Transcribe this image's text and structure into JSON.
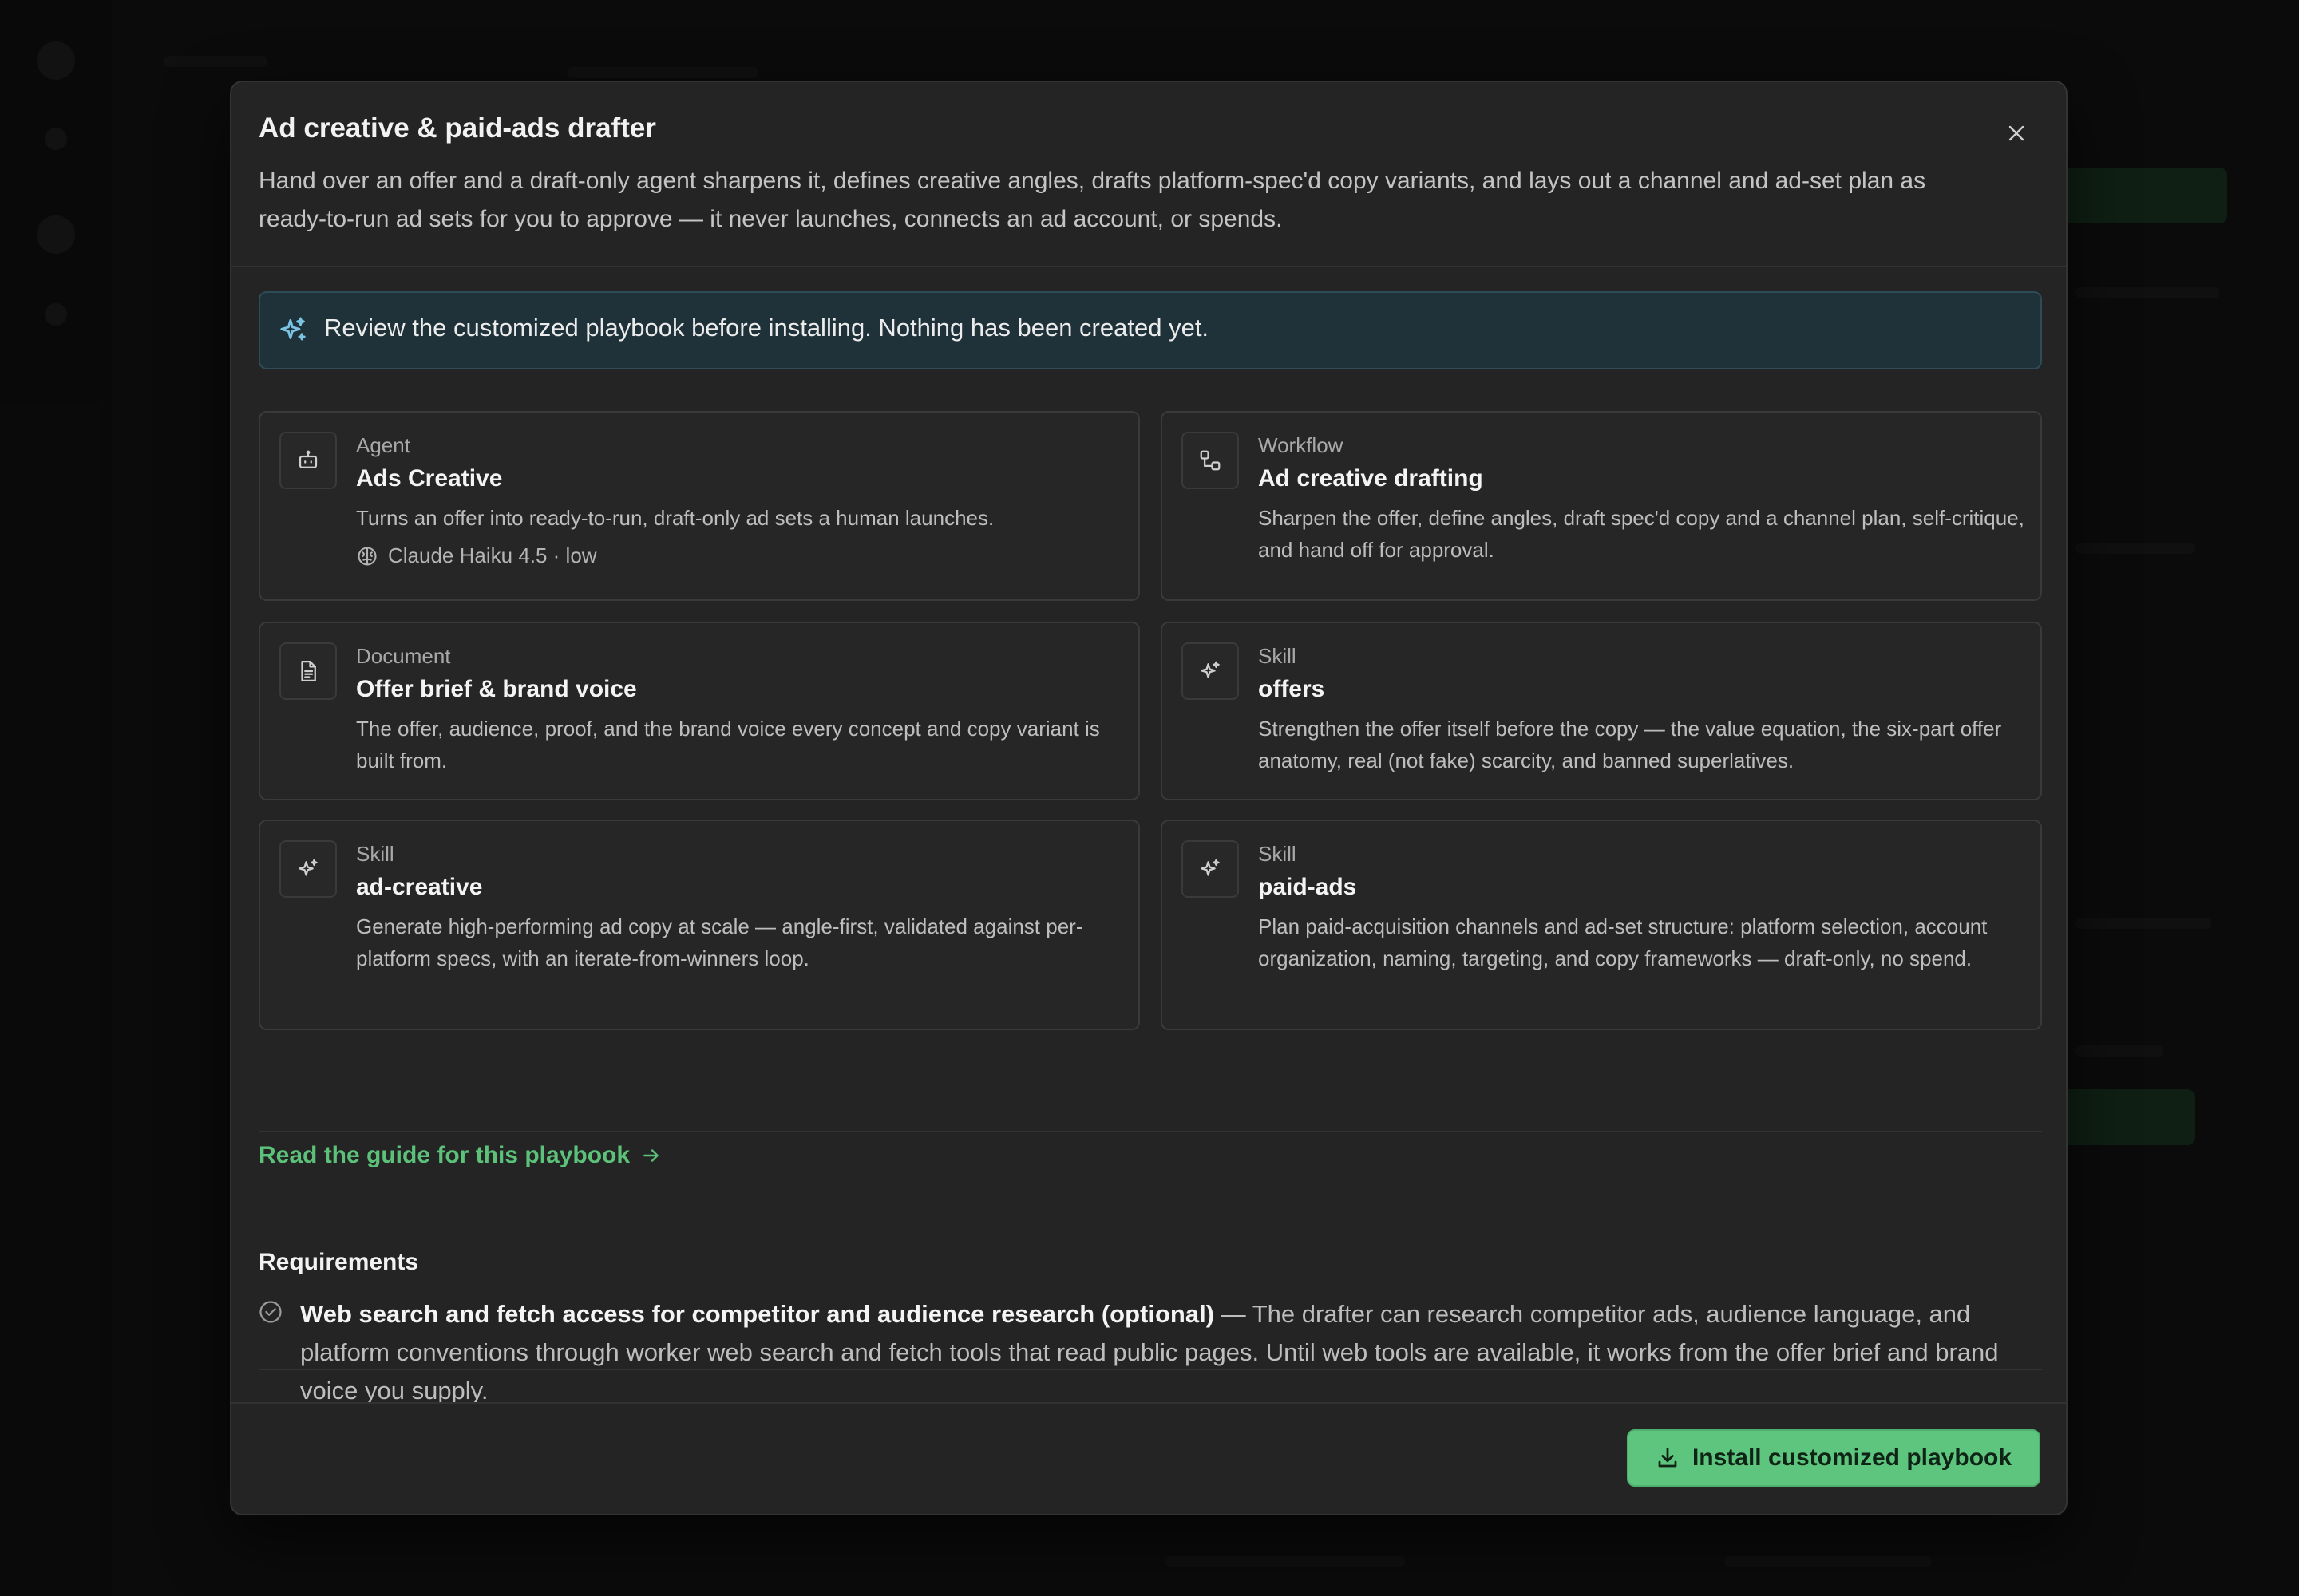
{
  "modal": {
    "title": "Ad creative & paid-ads drafter",
    "description": "Hand over an offer and a draft-only agent sharpens it, defines creative angles, drafts platform-spec'd copy variants, and lays out a channel and ad-set plan as ready-to-run ad sets for you to approve — it never launches, connects an ad account, or spends."
  },
  "banner": {
    "text": "Review the customized playbook before installing. Nothing has been created yet."
  },
  "cards": [
    {
      "kind": "Agent",
      "title": "Ads Creative",
      "description": "Turns an offer into ready-to-run, draft-only ad sets a human launches.",
      "model": "Claude Haiku 4.5 · low",
      "icon": "robot-icon"
    },
    {
      "kind": "Workflow",
      "title": "Ad creative drafting",
      "description": "Sharpen the offer, define angles, draft spec'd copy and a channel plan, self-critique, and hand off for approval.",
      "icon": "workflow-icon"
    },
    {
      "kind": "Document",
      "title": "Offer brief & brand voice",
      "description": "The offer, audience, proof, and the brand voice every concept and copy variant is built from.",
      "icon": "document-icon"
    },
    {
      "kind": "Skill",
      "title": "offers",
      "description": "Strengthen the offer itself before the copy — the value equation, the six-part offer anatomy, real (not fake) scarcity, and banned superlatives.",
      "icon": "sparkle-icon"
    },
    {
      "kind": "Skill",
      "title": "ad-creative",
      "description": "Generate high-performing ad copy at scale — angle-first, validated against per-platform specs, with an iterate-from-winners loop.",
      "icon": "sparkle-icon"
    },
    {
      "kind": "Skill",
      "title": "paid-ads",
      "description": "Plan paid-acquisition channels and ad-set structure: platform selection, account organization, naming, targeting, and copy frameworks — draft-only, no spend.",
      "icon": "sparkle-icon"
    }
  ],
  "guide_link": "Read the guide for this playbook",
  "requirements": {
    "title": "Requirements",
    "items": [
      {
        "name": "Web search and fetch access for competitor and audience research (optional)",
        "detail": " — The drafter can research competitor ads, audience language, and platform conventions through worker web search and fetch tools that read public pages. Until web tools are available, it works from the offer brief and brand voice you supply."
      }
    ]
  },
  "footer": {
    "install_label": "Install customized playbook"
  },
  "colors": {
    "accent": "#5dc57d",
    "banner_bg": "#1f323a",
    "link": "#5cc27a"
  }
}
